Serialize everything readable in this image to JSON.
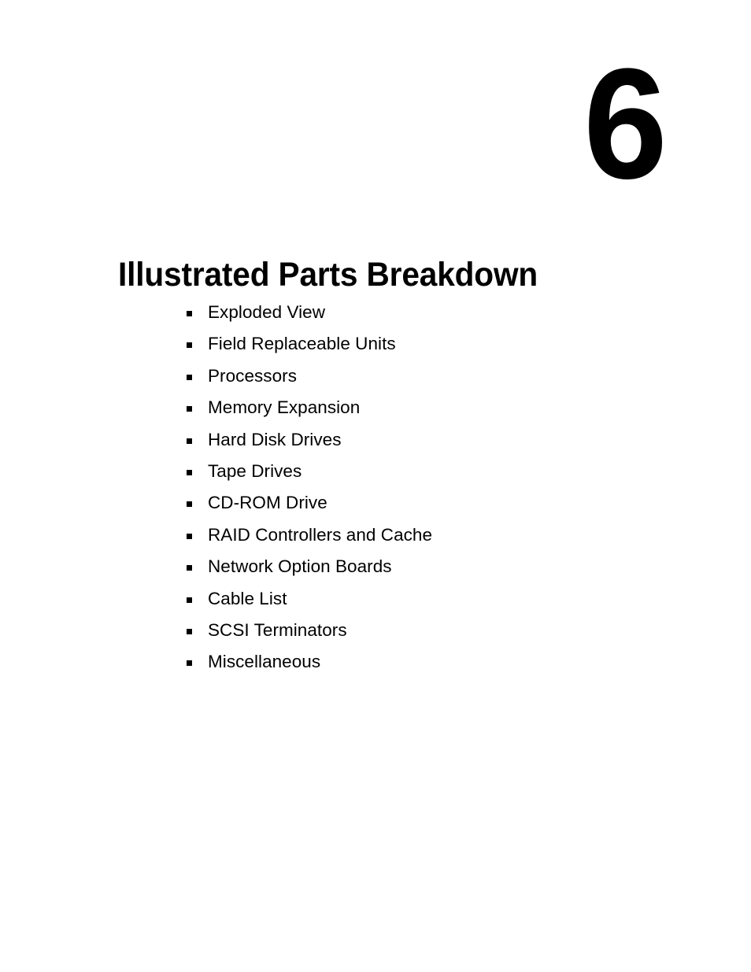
{
  "page": {
    "background_color": "#ffffff",
    "text_color": "#000000"
  },
  "chapter": {
    "number": "6",
    "title": "Illustrated Parts Breakdown"
  },
  "topics": [
    {
      "bullet": "square-bullet-icon",
      "label": "Exploded View"
    },
    {
      "bullet": "square-bullet-icon",
      "label": "Field Replaceable Units"
    },
    {
      "bullet": "square-bullet-icon",
      "label": "Processors"
    },
    {
      "bullet": "square-bullet-icon",
      "label": "Memory Expansion"
    },
    {
      "bullet": "square-bullet-icon",
      "label": "Hard Disk Drives"
    },
    {
      "bullet": "square-bullet-icon",
      "label": "Tape Drives"
    },
    {
      "bullet": "square-bullet-icon",
      "label": "CD-ROM Drive"
    },
    {
      "bullet": "square-bullet-icon",
      "label": "RAID Controllers and Cache"
    },
    {
      "bullet": "square-bullet-icon",
      "label": "Network Option Boards"
    },
    {
      "bullet": "square-bullet-icon",
      "label": "Cable List"
    },
    {
      "bullet": "square-bullet-icon",
      "label": "SCSI Terminators"
    },
    {
      "bullet": "square-bullet-icon",
      "label": "Miscellaneous"
    }
  ]
}
